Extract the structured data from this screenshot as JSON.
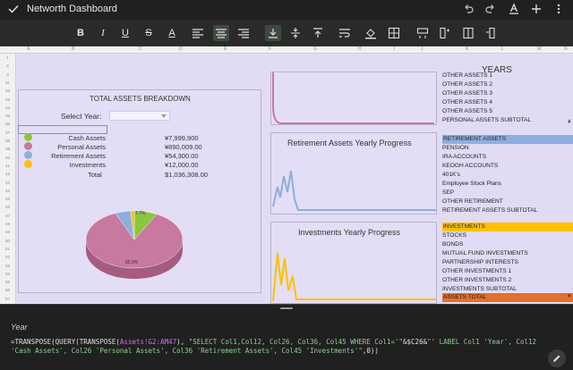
{
  "app": {
    "title": "Networth Dashboard"
  },
  "toolbar": {
    "bold": "B",
    "italic": "I",
    "underline": "U",
    "strike": "S",
    "textcolor": "A"
  },
  "sheet": {
    "columns": [
      "A",
      "B",
      "C",
      "D",
      "E",
      "F",
      "G",
      "H",
      "I",
      "J",
      "K",
      "L",
      "M",
      "N"
    ],
    "rows": [
      "1",
      "2",
      "3",
      "31",
      "32",
      "33",
      "34",
      "35",
      "36",
      "37",
      "38",
      "39",
      "40",
      "41",
      "42",
      "43",
      "44",
      "45",
      "46",
      "47",
      "48",
      "49",
      "50",
      "51",
      "52",
      "53",
      "54",
      "55",
      "56",
      "57"
    ]
  },
  "summary": {
    "title": "TOTAL ASSETS BREAKDOWN",
    "select_label": "Select Year:",
    "select_value": "",
    "items": [
      {
        "name": "Cash Assets",
        "value": "¥7,999,900",
        "color": "#8cc63f"
      },
      {
        "name": "Personal Assets",
        "value": "¥890,009.00",
        "color": "#c8799f"
      },
      {
        "name": "Retirement Assets",
        "value": "¥54,300.00",
        "color": "#8eaede"
      },
      {
        "name": "Investments",
        "value": "¥12,000.00",
        "color": "#ffc000"
      }
    ],
    "total_label": "Total",
    "total_value": "$1,036,308.00",
    "pie_labels": {
      "cash": "7.7%",
      "personal": "85.9%"
    }
  },
  "charts": {
    "retirement_title": "Retirement Assets Yearly Progress",
    "investments_title": "Investments Yearly Progress"
  },
  "right": {
    "years_header": "YEARS",
    "list_top": [
      "OTHER ASSETS 1",
      "OTHER ASSETS 2",
      "OTHER ASSETS 3",
      "OTHER ASSETS 4",
      "OTHER ASSETS 5",
      "PERSONAL ASSETS SUBTOTAL"
    ],
    "retirement_header": "RETIREMENT ASSETS",
    "retirement_items": [
      "PENSION",
      "IRA ACCOUNTS",
      "KEOGH ACCOUNTS",
      "401K's",
      "Employee Stock Plans",
      "SEP",
      "OTHER RETIREMENT",
      "RETIREMENT ASSETS SUBTOTAL"
    ],
    "investments_header": "INVESTMENTS",
    "investments_items": [
      "STOCKS",
      "BONDS",
      "MUTUAL FUND INVESTMENTS",
      "PARTNERSHIP INTERESTS",
      "OTHER INVESTMENTS 1",
      "OTHER INVESTMENTS 2",
      "INVESTMENTS SUBTOTAL"
    ],
    "assets_total": "ASSETS TOTAL",
    "subtotal_mark": "¥",
    "colors": {
      "retirement": "#8eaede",
      "investments": "#ffc000",
      "total": "#e2702a"
    }
  },
  "editor": {
    "cell_name": "Year",
    "formula_p1": "=TRANSPOSE(QUERY(TRANSPOSE(",
    "formula_range": "Assets!G2:AM47",
    "formula_p2": "), ",
    "formula_s1": "\"SELECT Col1,Col12, Col26, Col36, Col45 WHERE Col1='\"",
    "formula_p3": "&$C26&",
    "formula_s2": "\"' LABEL Col1 'Year', Col12 'Cash Assets', Col26 'Personal Assets', Col36 'Retirement Assets', Col45 'Investments'\"",
    "formula_p4": ",0))"
  }
}
